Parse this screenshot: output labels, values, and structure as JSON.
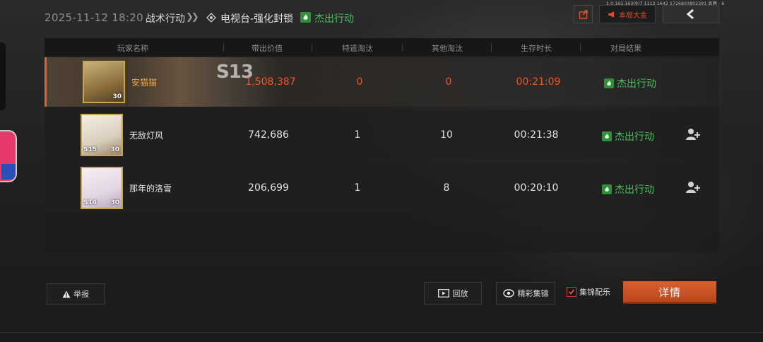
{
  "header": {
    "datetime": "2025-11-12 18:20",
    "mode": "战术行动",
    "map": "电视台-强化封锁",
    "result": "杰出行动",
    "total_button": "本局大金",
    "id_text": "1.0.163.163(9)7 1112 1642 1726803802391 品牌 - 6"
  },
  "table": {
    "columns": [
      "玩家名称",
      "带出价值",
      "特遣淘汰",
      "其他淘汰",
      "生存时长",
      "对局结果"
    ],
    "rows": [
      {
        "name": "安猫猫",
        "value": "1,508,387",
        "special_kills": "0",
        "other_kills": "0",
        "survival": "00:21:09",
        "result": "杰出行动",
        "level": "30",
        "season": "",
        "banner_text": "S13",
        "highlight": true
      },
      {
        "name": "无敌灯风",
        "value": "742,686",
        "special_kills": "1",
        "other_kills": "10",
        "survival": "00:21:38",
        "result": "杰出行动",
        "level": "30",
        "season": "S15",
        "highlight": false
      },
      {
        "name": "那年的洛雪",
        "value": "206,699",
        "special_kills": "1",
        "other_kills": "8",
        "survival": "00:20:10",
        "result": "杰出行动",
        "level": "30",
        "season": "S14",
        "highlight": false
      }
    ]
  },
  "footer": {
    "report": "举报",
    "replay": "回放",
    "highlights": "精彩集锦",
    "music": "集锦配乐",
    "detail": "详情"
  },
  "colors": {
    "accent": "#d9612f",
    "success": "#49c05a",
    "highlight_text": "#ea5a2b"
  },
  "icons": [
    "share-icon",
    "megaphone-icon",
    "back-arrow-icon",
    "chevron-right-icon",
    "target-icon",
    "flame-icon",
    "add-friend-icon",
    "warning-icon",
    "film-icon",
    "camera-icon",
    "checkbox-icon"
  ]
}
